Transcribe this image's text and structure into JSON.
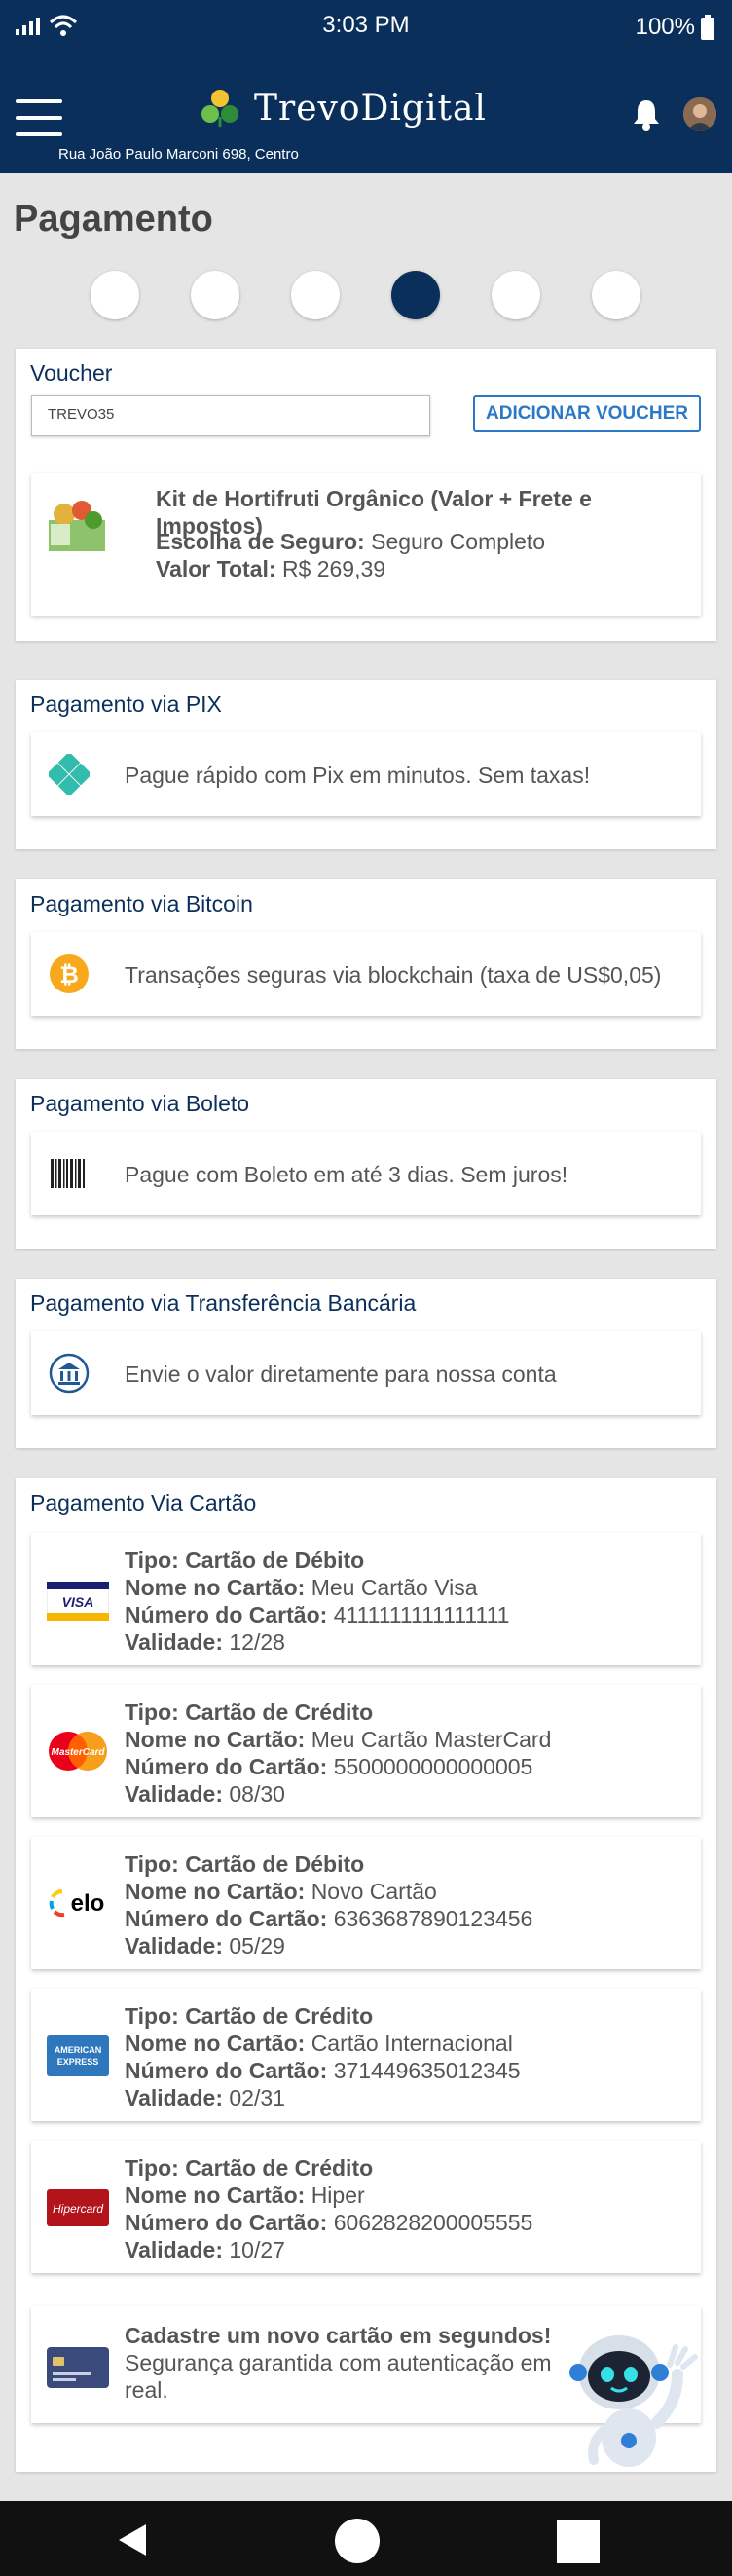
{
  "status": {
    "time": "3:03 PM",
    "battery": "100%"
  },
  "header": {
    "brand": "TrevoDigital",
    "address": "Rua João Paulo Marconi 698, Centro"
  },
  "page": {
    "title": "Pagamento"
  },
  "voucher": {
    "label": "Voucher",
    "code": "TREVO35",
    "button": "ADICIONAR VOUCHER",
    "product_title": "Kit de Hortifruti Orgânico (Valor + Frete e Impostos)",
    "insurance_label": "Escolha de Seguro:",
    "insurance_value": "Seguro Completo",
    "total_label": "Valor Total:",
    "total_value": "R$ 269,39"
  },
  "pix": {
    "title": "Pagamento via PIX",
    "text": "Pague rápido com Pix em minutos. Sem taxas!"
  },
  "bitcoin": {
    "title": "Pagamento via Bitcoin",
    "text": "Transações seguras via blockchain (taxa de US$0,05)"
  },
  "boleto": {
    "title": "Pagamento via Boleto",
    "text": "Pague com Boleto em até 3 dias. Sem juros!"
  },
  "transfer": {
    "title": "Pagamento via Transferência Bancária",
    "text": "Envie o valor diretamente para nossa conta"
  },
  "cards_section": {
    "title": "Pagamento Via Cartão",
    "labels": {
      "type": "Tipo:",
      "name": "Nome no Cartão:",
      "number": "Número do Cartão:",
      "validity": "Validade:"
    },
    "cards": [
      {
        "type": "Cartão de Débito",
        "name": "Meu Cartão Visa",
        "number": "4111111111111111",
        "validity": "12/28",
        "brand": "visa-icon"
      },
      {
        "type": "Cartão de Crédito",
        "name": "Meu Cartão MasterCard",
        "number": "5500000000000005",
        "validity": "08/30",
        "brand": "mastercard-icon"
      },
      {
        "type": "Cartão de Débito",
        "name": "Novo Cartão",
        "number": "6363687890123456",
        "validity": "05/29",
        "brand": "elo-icon"
      },
      {
        "type": "Cartão de Crédito",
        "name": "Cartão Internacional",
        "number": "371449635012345",
        "validity": "02/31",
        "brand": "amex-icon"
      },
      {
        "type": "Cartão de Crédito",
        "name": "Hiper",
        "number": "6062828200005555",
        "validity": "10/27",
        "brand": "hipercard-icon"
      }
    ],
    "new_card_title": "Cadastre um novo cartão em segundos!",
    "new_card_text": "Segurança garantida com autenticação em real."
  },
  "brand_logos": {
    "visa": "VISA",
    "mastercard": "MasterCard",
    "elo": "elo",
    "amex_1": "AMERICAN",
    "amex_2": "EXPRESS",
    "hipercard": "Hipercard"
  },
  "colors": {
    "primary": "#0b2f5b",
    "accent": "#2a78c6",
    "background": "#e5e5e5"
  }
}
